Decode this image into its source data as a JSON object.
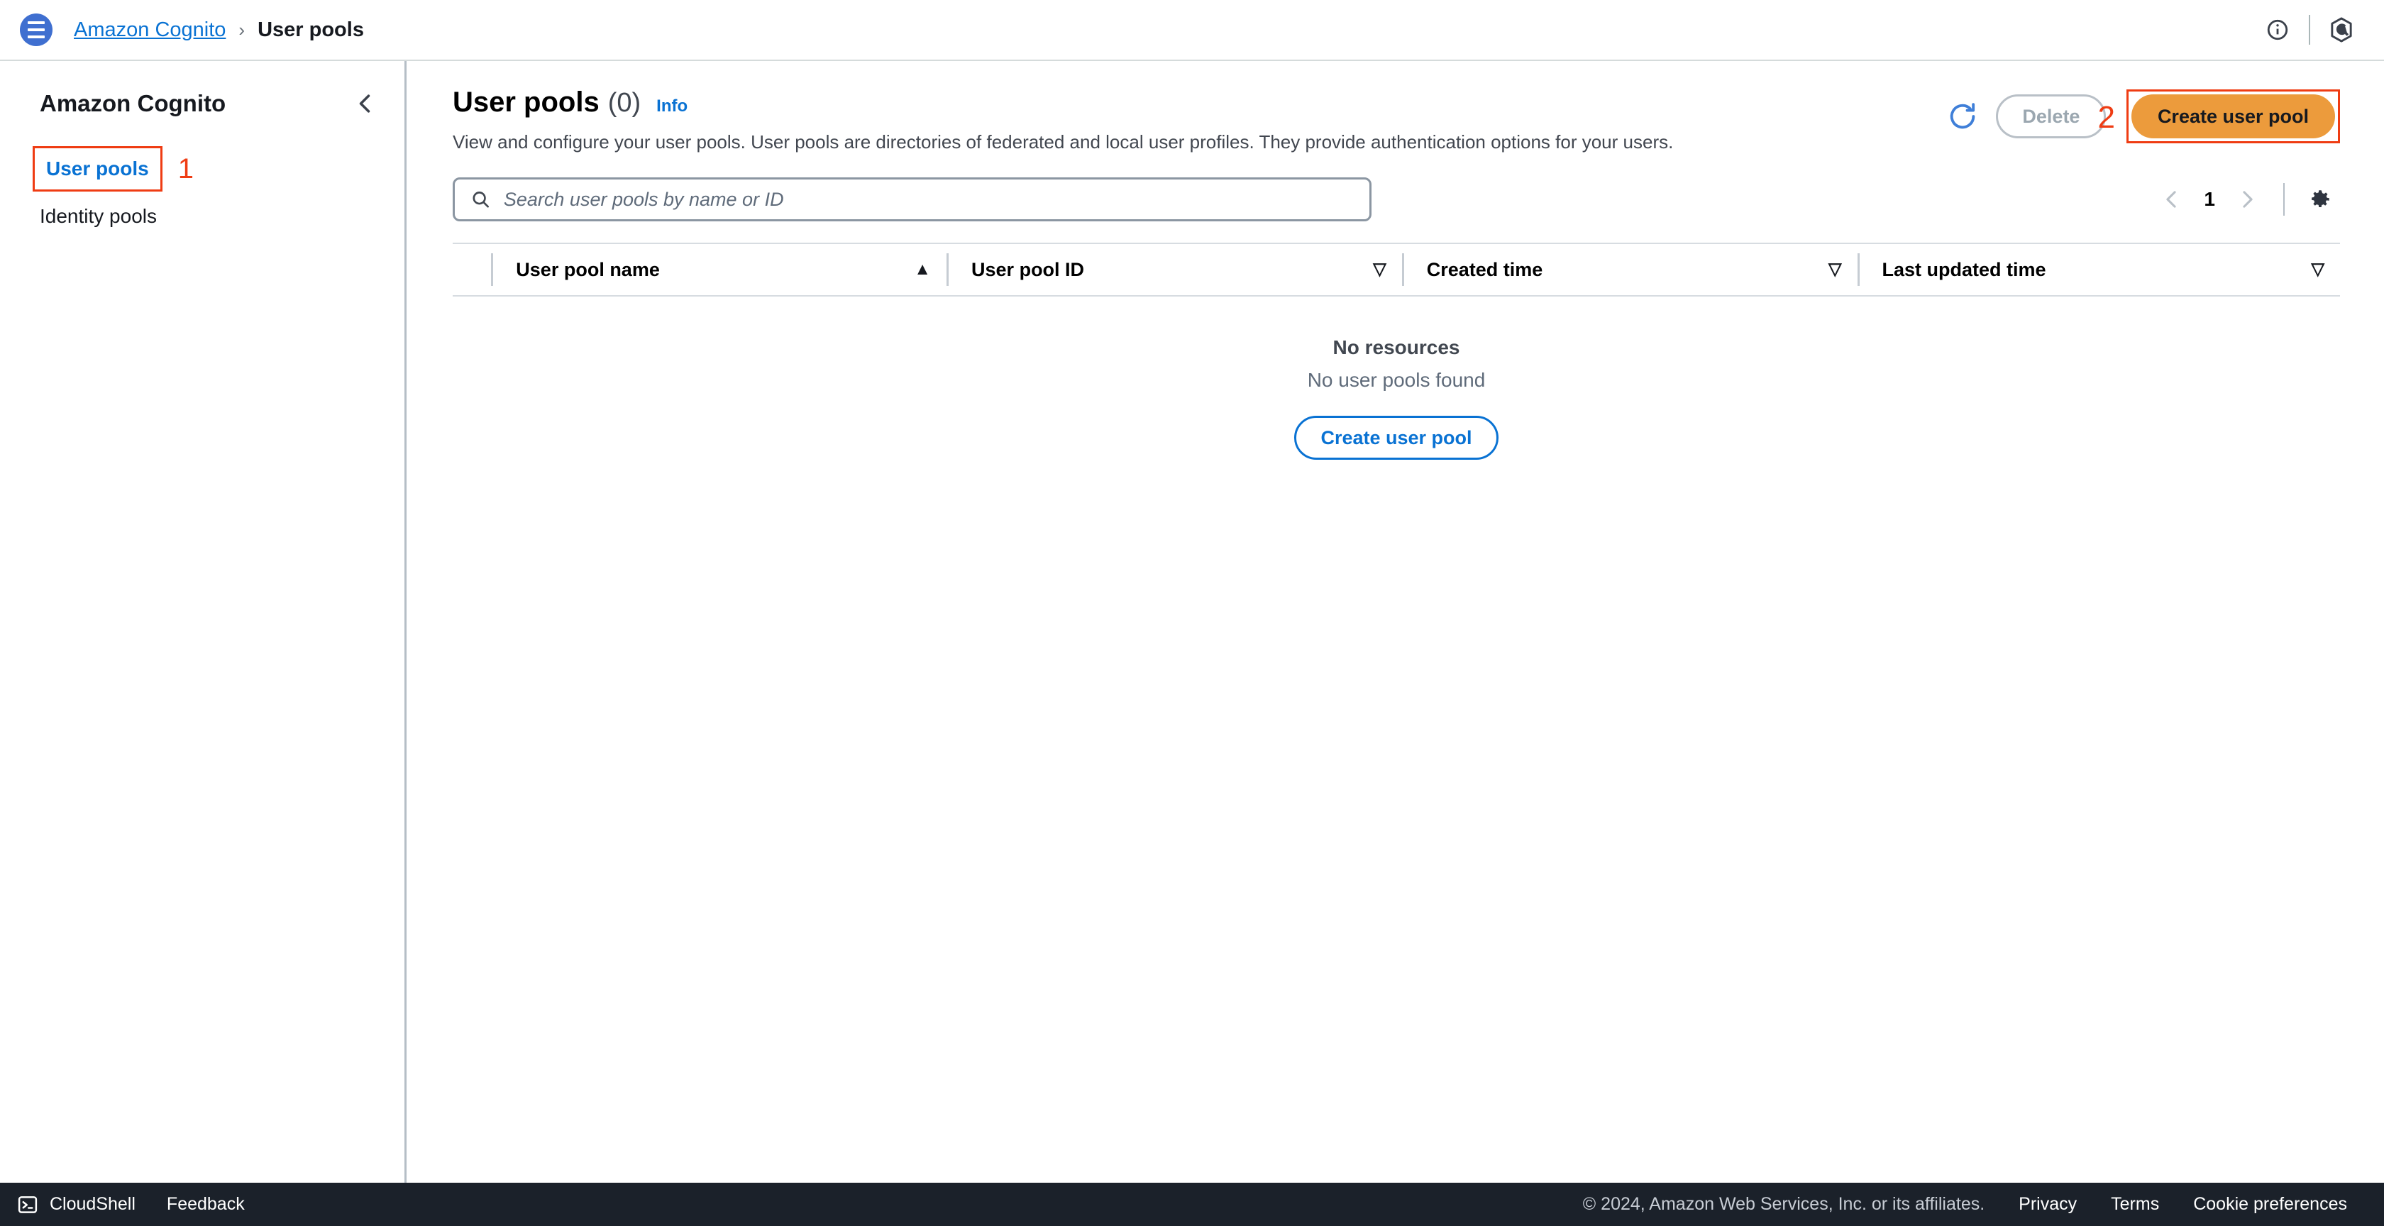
{
  "topbar": {
    "menu_icon": "hamburger-menu-icon",
    "breadcrumb": {
      "service": "Amazon Cognito",
      "separator": "›",
      "current": "User pools"
    },
    "info_icon": "info-circle-icon",
    "service_icon": "cognito-hexagon-icon"
  },
  "sidebar": {
    "title": "Amazon Cognito",
    "collapse_icon": "chevron-left-icon",
    "items": [
      {
        "label": "User pools",
        "active": true,
        "annotation": "1"
      },
      {
        "label": "Identity pools",
        "active": false
      }
    ]
  },
  "main": {
    "title": "User pools",
    "count": "(0)",
    "info_label": "Info",
    "description": "View and configure your user pools. User pools are directories of federated and local user profiles. They provide authentication options for your users.",
    "actions": {
      "refresh_icon": "refresh-icon",
      "delete_label": "Delete",
      "delete_annotation": "2",
      "create_label": "Create user pool"
    },
    "search": {
      "icon": "search-icon",
      "placeholder": "Search user pools by name or ID",
      "value": ""
    },
    "pagination": {
      "prev_icon": "chevron-left-icon",
      "page": "1",
      "next_icon": "chevron-right-icon",
      "settings_icon": "gear-icon"
    },
    "table": {
      "columns": [
        {
          "label": "User pool name",
          "sort": "▲",
          "sort_state": "ascending"
        },
        {
          "label": "User pool ID",
          "sort": "▽",
          "sort_state": "none"
        },
        {
          "label": "Created time",
          "sort": "▽",
          "sort_state": "none"
        },
        {
          "label": "Last updated time",
          "sort": "▽",
          "sort_state": "none"
        }
      ],
      "rows": [],
      "empty": {
        "title": "No resources",
        "subtitle": "No user pools found",
        "action_label": "Create user pool"
      }
    }
  },
  "footer": {
    "cloudshell_icon": "cloudshell-terminal-icon",
    "cloudshell_label": "CloudShell",
    "feedback_label": "Feedback",
    "copyright": "© 2024, Amazon Web Services, Inc. or its affiliates.",
    "links": [
      "Privacy",
      "Terms",
      "Cookie preferences"
    ]
  },
  "colors": {
    "accent_blue": "#0972d3",
    "primary_orange": "#ec9b3c",
    "annotation_red": "#ef3c13",
    "footer_dark": "#1b212a"
  }
}
